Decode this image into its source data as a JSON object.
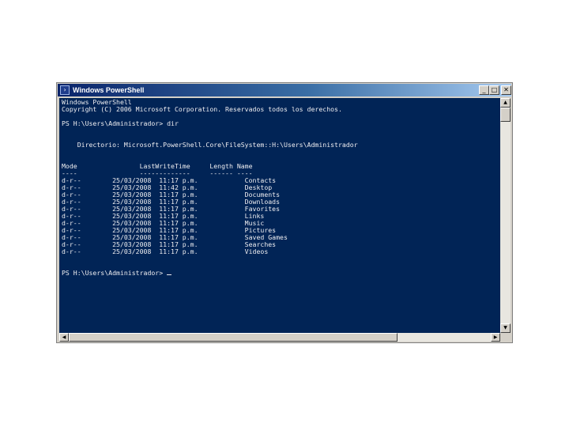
{
  "window": {
    "title": "Windows PowerShell",
    "buttons": {
      "minimize": "_",
      "maximize": "□",
      "close": "✕"
    }
  },
  "console": {
    "lines": [
      "Windows PowerShell",
      "Copyright (C) 2006 Microsoft Corporation. Reservados todos los derechos.",
      "",
      "PS H:\\Users\\Administrador> dir",
      "",
      "",
      "    Directorio: Microsoft.PowerShell.Core\\FileSystem::H:\\Users\\Administrador",
      "",
      "",
      "Mode                LastWriteTime     Length Name",
      "----                -------------     ------ ----",
      "d-r--        25/03/2008  11:17 p.m.            Contacts",
      "d-r--        25/03/2008  11:42 p.m.            Desktop",
      "d-r--        25/03/2008  11:17 p.m.            Documents",
      "d-r--        25/03/2008  11:17 p.m.            Downloads",
      "d-r--        25/03/2008  11:17 p.m.            Favorites",
      "d-r--        25/03/2008  11:17 p.m.            Links",
      "d-r--        25/03/2008  11:17 p.m.            Music",
      "d-r--        25/03/2008  11:17 p.m.            Pictures",
      "d-r--        25/03/2008  11:17 p.m.            Saved Games",
      "d-r--        25/03/2008  11:17 p.m.            Searches",
      "d-r--        25/03/2008  11:17 p.m.            Videos",
      "",
      "",
      "PS H:\\Users\\Administrador> "
    ],
    "background_color": "#012456",
    "text_color": "#eeedf0"
  },
  "scrollbars": {
    "up_arrow": "▲",
    "down_arrow": "▼",
    "left_arrow": "◀",
    "right_arrow": "▶"
  }
}
